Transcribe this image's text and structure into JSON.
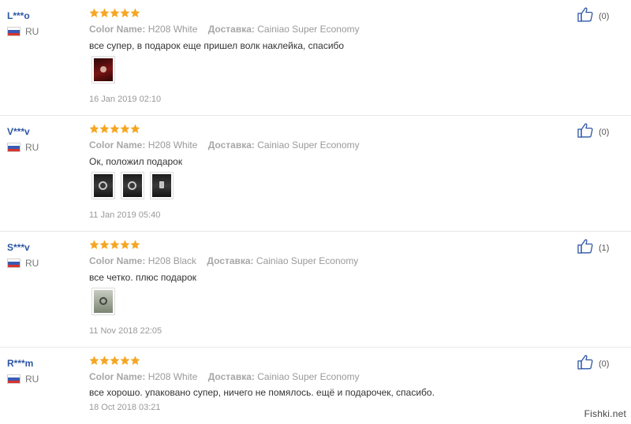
{
  "labels": {
    "color_name": "Color Name:",
    "delivery": "Доставка:"
  },
  "colors": {
    "star": "#f5a623",
    "user": "#2d55a4",
    "like_icon": "#2d55a4"
  },
  "reviews": [
    {
      "user": "L***o",
      "country": "RU",
      "rating": 5,
      "color_value": "H208 White",
      "delivery_value": "Cainiao Super Economy",
      "text": "все супер, в подарок еще пришел волк наклейка, спасибо",
      "images": [
        "red-phone-case-photo"
      ],
      "date": "16 Jan 2019 02:10",
      "likes": "(0)"
    },
    {
      "user": "V***v",
      "country": "RU",
      "rating": 5,
      "color_value": "H208 White",
      "delivery_value": "Cainiao Super Economy",
      "text": "Ок, положил подарок",
      "images": [
        "dark-phone-case-photo",
        "dark-phone-case-photo",
        "dark-phone-case-photo"
      ],
      "date": "11 Jan 2019 05:40",
      "likes": "(0)"
    },
    {
      "user": "S***v",
      "country": "RU",
      "rating": 5,
      "color_value": "H208 Black",
      "delivery_value": "Cainiao Super Economy",
      "text": "все четко. плюс подарок",
      "images": [
        "green-phone-case-photo"
      ],
      "date": "11 Nov 2018 22:05",
      "likes": "(1)"
    },
    {
      "user": "R***m",
      "country": "RU",
      "rating": 5,
      "color_value": "H208 White",
      "delivery_value": "Cainiao Super Economy",
      "text": "все хорошо. упаковано супер, ничего не помялось. ещё и подарочек, спасибо.",
      "images": [],
      "date": "18 Oct 2018 03:21",
      "likes": "(0)"
    }
  ],
  "watermark": "Fishki.net"
}
